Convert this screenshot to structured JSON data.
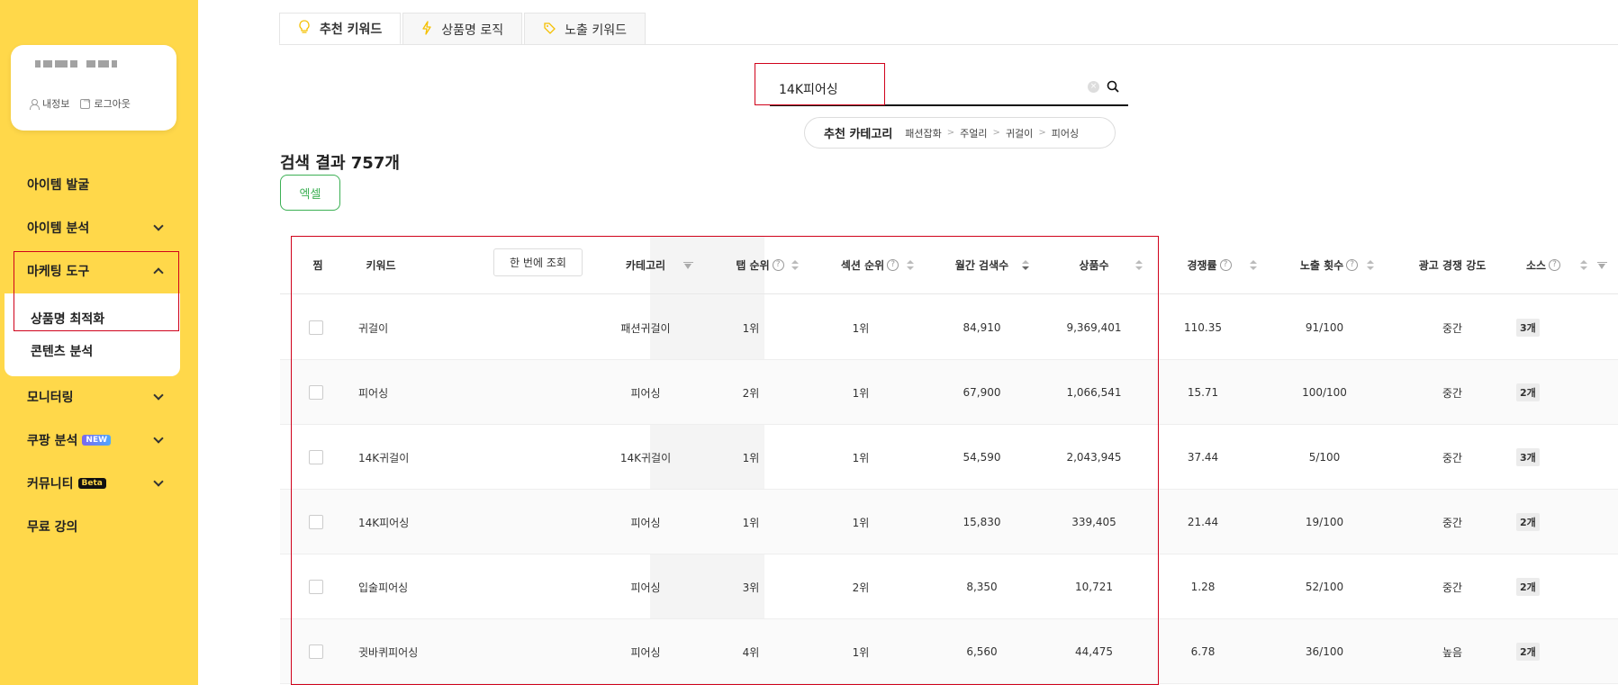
{
  "sidebar": {
    "profile": {
      "links": [
        "내정보",
        "로그아웃"
      ]
    },
    "nav": [
      {
        "label": "아이템 발굴",
        "chevron": "none"
      },
      {
        "label": "아이템 분석",
        "chevron": "down"
      },
      {
        "label": "마케팅 도구",
        "chevron": "up"
      },
      {
        "label": "모니터링",
        "chevron": "down"
      },
      {
        "label": "쿠팡 분석",
        "chevron": "down",
        "badge": "NEW"
      },
      {
        "label": "커뮤니티",
        "chevron": "down",
        "badge": "Beta"
      },
      {
        "label": "무료 강의",
        "chevron": "none"
      }
    ],
    "sub_items": [
      "상품명 최적화",
      "콘텐츠 분석"
    ]
  },
  "tabs": [
    {
      "label": "추천 키워드",
      "icon": "lightbulb-icon",
      "active": true
    },
    {
      "label": "상품명 로직",
      "icon": "lightning-icon",
      "active": false
    },
    {
      "label": "노출 키워드",
      "icon": "tag-icon",
      "active": false
    }
  ],
  "search": {
    "value": "14K피어싱"
  },
  "category": {
    "title": "추천 카테고리",
    "path": [
      "패션잡화",
      "주얼리",
      "귀걸이",
      "피어싱"
    ]
  },
  "results": {
    "title": "검색 결과 757개",
    "excel_label": "엑셀"
  },
  "table": {
    "lookup_label": "한 번에 조회",
    "headers": [
      "찜",
      "키워드",
      "카테고리",
      "탭 순위",
      "섹션 순위",
      "월간 검색수",
      "상품수",
      "경쟁률",
      "노출 횟수",
      "광고 경쟁 강도",
      "소스"
    ],
    "rows": [
      {
        "keyword": "귀걸이",
        "category": "패션귀걸이",
        "tab_rank": "1위",
        "section_rank": "1위",
        "monthly": "84,910",
        "products": "9,369,401",
        "competition": "110.35",
        "exposure": "91/100",
        "ad": "중간",
        "source": "3개"
      },
      {
        "keyword": "피어싱",
        "category": "피어싱",
        "tab_rank": "2위",
        "section_rank": "1위",
        "monthly": "67,900",
        "products": "1,066,541",
        "competition": "15.71",
        "exposure": "100/100",
        "ad": "중간",
        "source": "2개"
      },
      {
        "keyword": "14K귀걸이",
        "category": "14K귀걸이",
        "tab_rank": "1위",
        "section_rank": "1위",
        "monthly": "54,590",
        "products": "2,043,945",
        "competition": "37.44",
        "exposure": "5/100",
        "ad": "중간",
        "source": "3개"
      },
      {
        "keyword": "14K피어싱",
        "category": "피어싱",
        "tab_rank": "1위",
        "section_rank": "1위",
        "monthly": "15,830",
        "products": "339,405",
        "competition": "21.44",
        "exposure": "19/100",
        "ad": "중간",
        "source": "2개"
      },
      {
        "keyword": "입술피어싱",
        "category": "피어싱",
        "tab_rank": "3위",
        "section_rank": "2위",
        "monthly": "8,350",
        "products": "10,721",
        "competition": "1.28",
        "exposure": "52/100",
        "ad": "중간",
        "source": "2개"
      },
      {
        "keyword": "귓바퀴피어싱",
        "category": "피어싱",
        "tab_rank": "4위",
        "section_rank": "1위",
        "monthly": "6,560",
        "products": "44,475",
        "competition": "6.78",
        "exposure": "36/100",
        "ad": "높음",
        "source": "2개"
      }
    ]
  },
  "colors": {
    "sidebar_bg": "#ffd84a",
    "excel_green": "#3cb054",
    "highlight_red": "#d0021b"
  }
}
